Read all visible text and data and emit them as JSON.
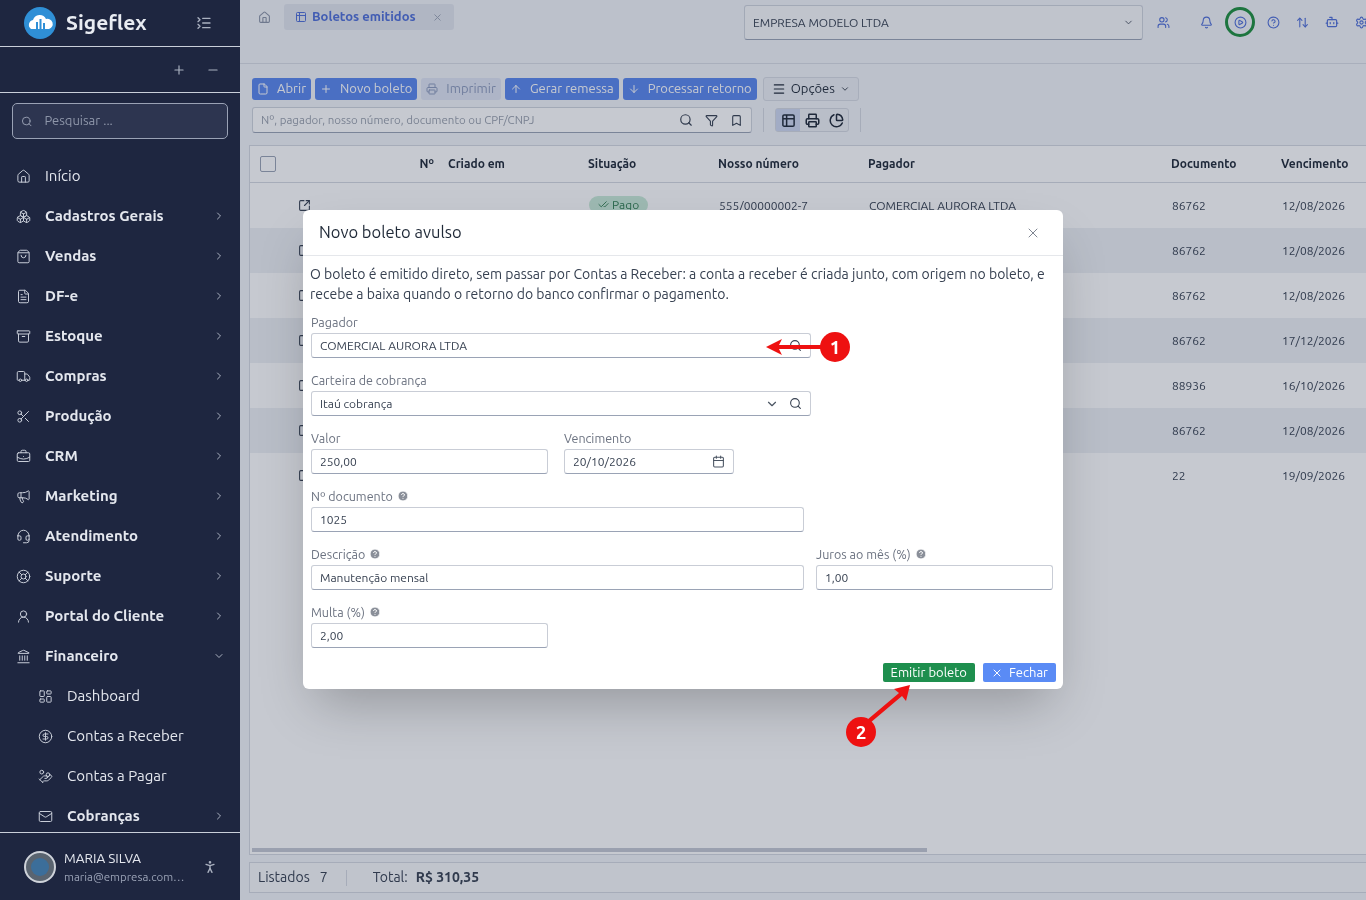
{
  "sidebar": {
    "brand": "Sigeflex",
    "search": {
      "placeholder": "Pesquisar ..."
    },
    "items": [
      {
        "label": "Início",
        "kind": "link"
      },
      {
        "label": "Cadastros Gerais",
        "kind": "group",
        "expanded": false
      },
      {
        "label": "Vendas",
        "kind": "group",
        "expanded": false
      },
      {
        "label": "DF-e",
        "kind": "group",
        "expanded": false
      },
      {
        "label": "Estoque",
        "kind": "group",
        "expanded": false
      },
      {
        "label": "Compras",
        "kind": "group",
        "expanded": false
      },
      {
        "label": "Produção",
        "kind": "group",
        "expanded": false
      },
      {
        "label": "CRM",
        "kind": "group",
        "expanded": false
      },
      {
        "label": "Marketing",
        "kind": "group",
        "expanded": false
      },
      {
        "label": "Atendimento",
        "kind": "group",
        "expanded": false
      },
      {
        "label": "Suporte",
        "kind": "group",
        "expanded": false
      },
      {
        "label": "Portal do Cliente",
        "kind": "group",
        "expanded": false
      },
      {
        "label": "Financeiro",
        "kind": "group",
        "expanded": true,
        "children": [
          {
            "label": "Dashboard",
            "kind": "link"
          },
          {
            "label": "Contas a Receber",
            "kind": "link"
          },
          {
            "label": "Contas a Pagar",
            "kind": "link"
          },
          {
            "label": "Cobranças",
            "kind": "group",
            "expanded": false
          }
        ]
      }
    ],
    "user": {
      "name": "MARIA SILVA",
      "email": "maria@empresa.com…"
    }
  },
  "topbar": {
    "tab": {
      "label": "Boletos emitidos"
    },
    "company": "EMPRESA MODELO LTDA"
  },
  "toolbar": {
    "buttons": [
      {
        "label": "Abrir",
        "disabled": false
      },
      {
        "label": "Novo boleto",
        "disabled": false
      },
      {
        "label": "Imprimir",
        "disabled": true
      },
      {
        "label": "Gerar remessa",
        "disabled": false
      },
      {
        "label": "Processar retorno",
        "disabled": false
      }
    ],
    "options": "Opções",
    "search": {
      "placeholder": "Nº, pagador, nosso número, documento ou CPF/CNPJ"
    },
    "views": [
      {
        "selected": true
      },
      {
        "selected": false
      },
      {
        "selected": false
      }
    ]
  },
  "table": {
    "select_all": {
      "checked": false
    },
    "columns": [
      "Nº",
      "Criado em",
      "Situação",
      "Nosso número",
      "Pagador",
      "Documento",
      "Vencimento"
    ],
    "rows": [
      {
        "situacao": "Pago",
        "nosso_numero": "555/00000002-7",
        "pagador": "COMERCIAL AURORA LTDA",
        "documento": "86762",
        "vencimento": "12/08/2026"
      },
      {
        "documento": "86762",
        "vencimento": "12/08/2026"
      },
      {
        "documento": "86762",
        "vencimento": "12/08/2026"
      },
      {
        "documento": "86762",
        "vencimento": "17/12/2026"
      },
      {
        "documento": "88936",
        "vencimento": "16/10/2026"
      },
      {
        "documento": "86762",
        "vencimento": "12/08/2026"
      },
      {
        "documento": "22",
        "vencimento": "19/09/2026"
      }
    ]
  },
  "status_bar": {
    "listed_label": "Listados",
    "listed": "7",
    "total_label": "Total:",
    "total": "R$ 310,35"
  },
  "modal": {
    "title": "Novo boleto avulso",
    "description": "O boleto é emitido direto, sem passar por Contas a Receber: a conta a receber é criada junto, com origem no boleto, e recebe a baixa quando o retorno do banco confirmar o pagamento.",
    "fields": [
      {
        "label": "Pagador",
        "value": "COMERCIAL AURORA LTDA",
        "kind": "lookup",
        "help": false
      },
      {
        "label": "Carteira de cobrança",
        "value": "Itaú cobrança",
        "kind": "select",
        "help": false
      },
      {
        "label": "Valor",
        "value": "250,00",
        "kind": "text",
        "help": false
      },
      {
        "label": "Vencimento",
        "value": "20/10/2026",
        "kind": "date",
        "help": false
      },
      {
        "label": "Nº documento",
        "value": "1025",
        "kind": "text",
        "help": true
      },
      {
        "label": "Descrição",
        "value": "Manutenção mensal",
        "kind": "text",
        "help": true
      },
      {
        "label": "Juros ao mês (%)",
        "value": "1,00",
        "kind": "text",
        "help": true
      },
      {
        "label": "Multa (%)",
        "value": "2,00",
        "kind": "text",
        "help": true
      }
    ],
    "buttons": [
      {
        "label": "Emitir boleto",
        "kind": "primary"
      },
      {
        "label": "Fechar",
        "kind": "close"
      }
    ]
  },
  "annotations": [
    {
      "label": "1"
    },
    {
      "label": "2"
    }
  ]
}
